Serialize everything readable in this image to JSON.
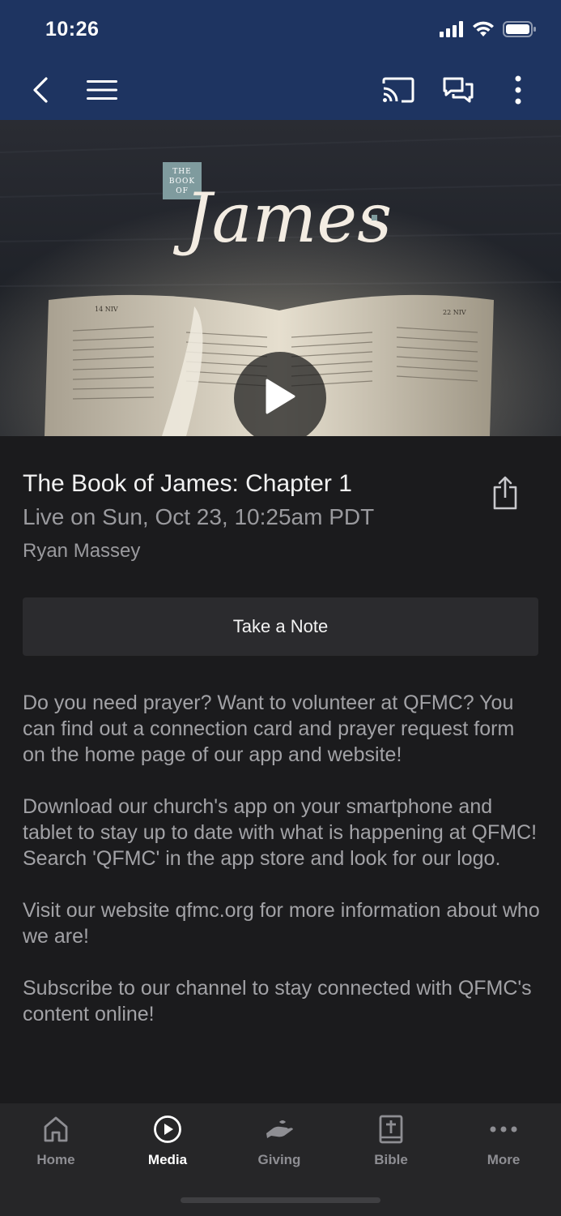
{
  "status_bar": {
    "time": "10:26",
    "icons": [
      "signal-icon",
      "wifi-icon",
      "battery-icon"
    ]
  },
  "nav": {
    "icons": [
      "back-icon",
      "menu-icon",
      "cast-icon",
      "chat-icon",
      "more-vertical-icon"
    ]
  },
  "hero": {
    "badge_lines": [
      "THE",
      "BOOK",
      "OF"
    ],
    "script_title": "James",
    "page_left": "14 NIV",
    "page_right": "22 NIV"
  },
  "media": {
    "title": "The Book of James: Chapter 1",
    "subtitle": "Live on Sun, Oct 23, 10:25am PDT",
    "speaker": "Ryan Massey",
    "note_button": "Take a Note"
  },
  "description": [
    "Do you need prayer? Want to volunteer at QFMC? You can find out a connection card and prayer request form on the home page of our app and website!",
    "Download our church's app on your smartphone and tablet to stay up to date with what is happening at QFMC! Search 'QFMC' in the app store and look for our logo.",
    "Visit our website qfmc.org for more information about who we are!",
    "Subscribe to our channel to stay connected with QFMC's content online!"
  ],
  "tabs": [
    {
      "label": "Home",
      "icon": "home-icon",
      "active": false
    },
    {
      "label": "Media",
      "icon": "play-circle-icon",
      "active": true
    },
    {
      "label": "Giving",
      "icon": "giving-hand-icon",
      "active": false
    },
    {
      "label": "Bible",
      "icon": "bible-icon",
      "active": false
    },
    {
      "label": "More",
      "icon": "more-horizontal-icon",
      "active": false
    }
  ],
  "colors": {
    "header": "#1e3461",
    "background": "#1b1b1d",
    "tab_bar": "#262628",
    "muted_text": "#9a9a9e"
  }
}
